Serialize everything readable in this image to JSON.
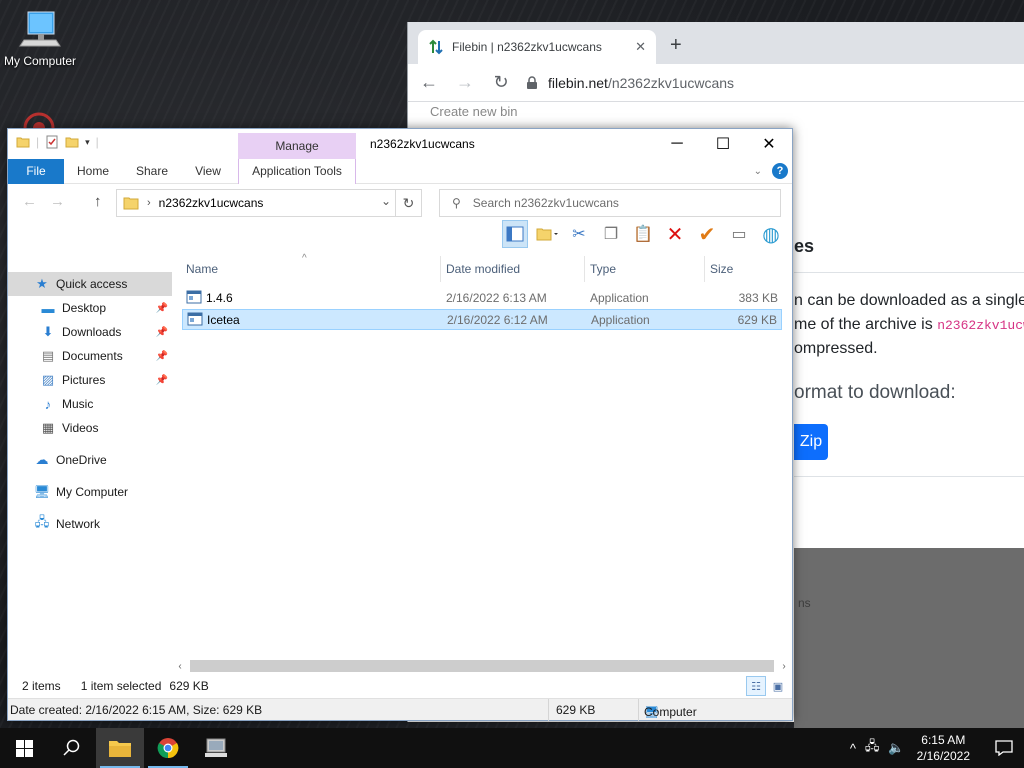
{
  "desktop": {
    "icons": [
      {
        "label": "My Computer",
        "icon": "computer-icon"
      }
    ]
  },
  "browser": {
    "tab_title": "Filebin | n2362zkv1ucwcans",
    "tab_close": "✕",
    "new_tab": "+",
    "url_host": "filebin.net",
    "url_path": "/n2362zkv1ucwcans",
    "faded_text": "Create new bin",
    "heading": "es",
    "line1": "n can be downloaded as a single",
    "line2_prefix": "me of the archive is",
    "line2_code": "n2362zkv1ucw",
    "line3": "ompressed.",
    "format_text": "ormat to download:",
    "zip_button": "Zip",
    "grey_text": "ns"
  },
  "explorer": {
    "manage_tab": "Manage",
    "window_title": "n2362zkv1ucwcans",
    "ribbon_tabs": {
      "file": "File",
      "home": "Home",
      "share": "Share",
      "view": "View",
      "app_tools": "Application Tools"
    },
    "address": "n2362zkv1ucwcans",
    "search_placeholder": "Search n2362zkv1ucwcans",
    "nav_pane": [
      {
        "label": "Quick access",
        "icon": "star-icon",
        "selected": true
      },
      {
        "label": "Desktop",
        "icon": "desktop-icon",
        "pinned": true
      },
      {
        "label": "Downloads",
        "icon": "download-icon",
        "pinned": true
      },
      {
        "label": "Documents",
        "icon": "documents-icon",
        "pinned": true
      },
      {
        "label": "Pictures",
        "icon": "pictures-icon",
        "pinned": true
      },
      {
        "label": "Music",
        "icon": "music-icon"
      },
      {
        "label": "Videos",
        "icon": "videos-icon"
      },
      {
        "label": "OneDrive",
        "icon": "cloud-icon"
      },
      {
        "label": "My Computer",
        "icon": "computer-icon"
      },
      {
        "label": "Network",
        "icon": "network-icon"
      }
    ],
    "columns": {
      "name": "Name",
      "date": "Date modified",
      "type": "Type",
      "size": "Size"
    },
    "files": [
      {
        "name": "1.4.6",
        "date": "2/16/2022 6:13 AM",
        "type": "Application",
        "size": "383 KB",
        "selected": false
      },
      {
        "name": "Icetea",
        "date": "2/16/2022 6:12 AM",
        "type": "Application",
        "size": "629 KB",
        "selected": true
      }
    ],
    "status": {
      "items": "2 items",
      "selected": "1 item selected",
      "size": "629 KB"
    },
    "details": {
      "created": "Date created: 2/16/2022 6:15 AM, Size: 629 KB",
      "size": "629 KB",
      "location": "Computer"
    }
  },
  "taskbar": {
    "time": "6:15 AM",
    "date": "2/16/2022"
  },
  "colors": {
    "accent": "#1979ca",
    "manage": "#e8d0f4",
    "selection": "#cce8ff",
    "zip": "#0d6efd"
  }
}
